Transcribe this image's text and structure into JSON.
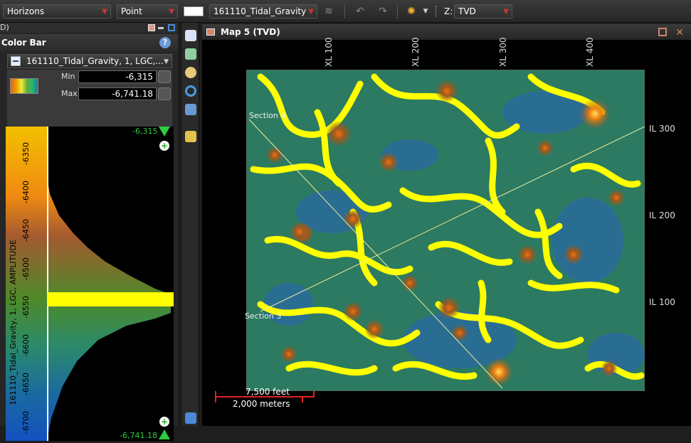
{
  "toolbar": {
    "layer_type": "Horizons",
    "display_mode": "Point",
    "horizon_name": "161110_Tidal_Gravity",
    "z_prefix": "Z:",
    "z_domain": "TVD"
  },
  "left_panel": {
    "header_fragment": "D)",
    "title": "Color Bar",
    "attribute_select": "161110_Tidal_Gravity, 1, LGC,...",
    "min_label": "Min",
    "min_value": "-6,315",
    "max_label": "Max",
    "max_value": "-6,741.18",
    "top_marker": "-6,315",
    "bottom_marker": "-6,741.18",
    "axis_title": "161110_Tidal_Gravity, 1, LGC, AMPLITUDE",
    "ticks": [
      "-6350",
      "-6400",
      "-6450",
      "-6500",
      "-6550",
      "-6600",
      "-6650",
      "-6700"
    ]
  },
  "map_window": {
    "title": "Map 5 (TVD)",
    "xl_labels": [
      "XL 100",
      "XL 200",
      "XL 300",
      "XL 400"
    ],
    "il_labels": [
      "IL 300",
      "IL 200",
      "IL 100"
    ],
    "section_labels": [
      "Section 4",
      "Section 3"
    ],
    "scale_feet": "7,500 feet",
    "scale_meters": "2,000 meters"
  }
}
